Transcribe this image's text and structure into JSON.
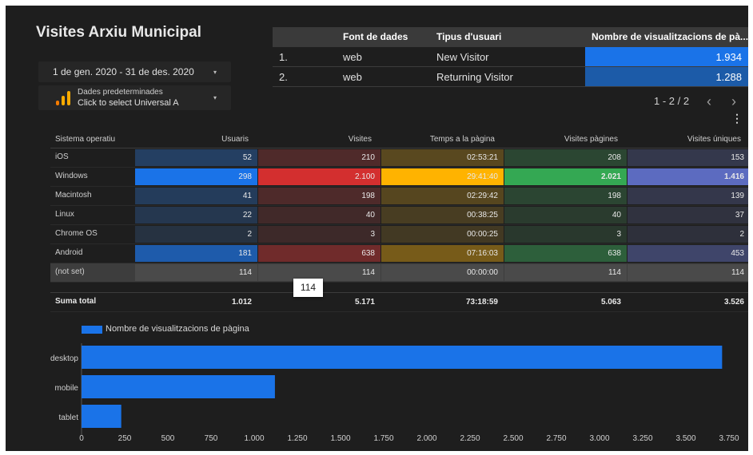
{
  "report": {
    "title": "Visites Arxiu Municipal"
  },
  "controls": {
    "date_range": "1 de gen. 2020 - 31 de des. 2020",
    "data_source_line1": "Dades predeterminades",
    "data_source_line2": "Click to select Universal A",
    "caret_icon": "▾"
  },
  "top_table": {
    "headers": [
      "Font de dades",
      "Tipus d'usuari",
      "Nombre de visualitzacions de pà..."
    ],
    "rows": [
      {
        "n": "1.",
        "source": "web",
        "user_type": "New Visitor",
        "views": "1.934",
        "views_value": 1934
      },
      {
        "n": "2.",
        "source": "web",
        "user_type": "Returning Visitor",
        "views": "1.288",
        "views_value": 1288
      }
    ],
    "pager": "1 - 2 / 2",
    "prev_icon": "‹",
    "next_icon": "›",
    "menu_icon": "⋮"
  },
  "os_table": {
    "headers": [
      "Sistema operatiu",
      "Usuaris",
      "Visites",
      "Temps a la pàgina",
      "Visites pàgines",
      "Visites úniques"
    ],
    "rows": [
      {
        "os": "iOS",
        "v": [
          "52",
          "210",
          "02:53:21",
          "208",
          "153"
        ]
      },
      {
        "os": "Windows",
        "v": [
          "298",
          "2.100",
          "29:41:40",
          "2.021",
          "1.416"
        ]
      },
      {
        "os": "Macintosh",
        "v": [
          "41",
          "198",
          "02:29:42",
          "198",
          "139"
        ]
      },
      {
        "os": "Linux",
        "v": [
          "22",
          "40",
          "00:38:25",
          "40",
          "37"
        ]
      },
      {
        "os": "Chrome OS",
        "v": [
          "2",
          "3",
          "00:00:25",
          "3",
          "2"
        ]
      },
      {
        "os": "Android",
        "v": [
          "181",
          "638",
          "07:16:03",
          "638",
          "453"
        ]
      },
      {
        "os": "(not set)",
        "v": [
          "114",
          "114",
          "00:00:00",
          "114",
          "114"
        ]
      }
    ],
    "total": {
      "label": "Suma total",
      "v": [
        "1.012",
        "5.171",
        "73:18:59",
        "5.063",
        "3.526"
      ]
    },
    "tooltip": "114",
    "column_colors": [
      "#1a73e8",
      "#d32f2f",
      "#ffb300",
      "#34a853",
      "#5c6bc0"
    ]
  },
  "chart_data": {
    "type": "bar",
    "orientation": "horizontal",
    "categories": [
      "desktop",
      "mobile",
      "tablet"
    ],
    "series": [
      {
        "name": "Nombre de visualitzacions de pàgina",
        "values": [
          3710,
          1120,
          230
        ],
        "color": "#1a73e8"
      }
    ],
    "xlim": [
      0,
      3750
    ],
    "xticks": [
      "0",
      "250",
      "500",
      "750",
      "1.000",
      "1.250",
      "1.500",
      "1.750",
      "2.000",
      "2.250",
      "2.500",
      "2.750",
      "3.000",
      "3.250",
      "3.500",
      "3.750"
    ],
    "grid": false,
    "legend_position": "top-left"
  }
}
